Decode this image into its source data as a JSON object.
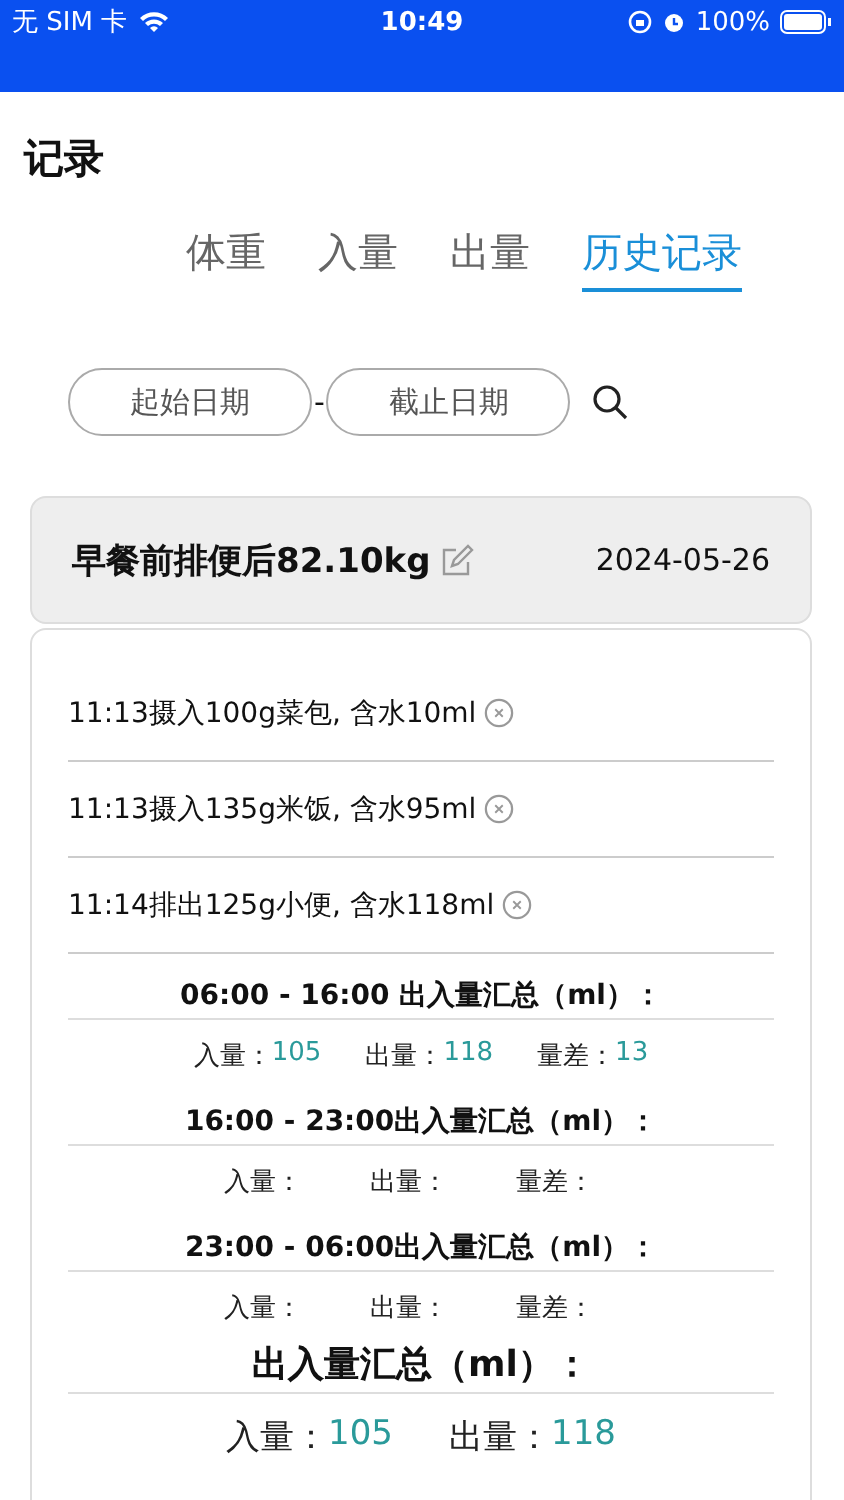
{
  "status_bar": {
    "carrier": "无 SIM 卡",
    "time": "10:49",
    "battery": "100%"
  },
  "title": "记录",
  "tabs": [
    {
      "label": "体重",
      "selected": false
    },
    {
      "label": "入量",
      "selected": false
    },
    {
      "label": "出量",
      "selected": false
    },
    {
      "label": "历史记录",
      "selected": true
    }
  ],
  "date_filter": {
    "start_placeholder": "起始日期",
    "separator": "-",
    "end_placeholder": "截止日期"
  },
  "record": {
    "weight": "早餐前排便后82.10kg",
    "date": "2024-05-26",
    "entries": [
      "11:13摄入100g菜包, 含水10ml",
      "11:13摄入135g米饭, 含水95ml",
      "11:14排出125g小便, 含水118ml"
    ],
    "summaries": [
      {
        "kind": "period",
        "title": "06:00 - 16:00 出入量汇总（ml）：",
        "items": [
          {
            "label": "入量：",
            "value": "105"
          },
          {
            "label": "出量：",
            "value": "118"
          },
          {
            "label": "量差：",
            "value": "13"
          }
        ]
      },
      {
        "kind": "period",
        "title": "16:00 - 23:00出入量汇总（ml）：",
        "items": [
          {
            "label": "入量："
          },
          {
            "label": "出量："
          },
          {
            "label": "量差："
          }
        ]
      },
      {
        "kind": "period",
        "title": "23:00 - 06:00出入量汇总（ml）：",
        "items": [
          {
            "label": "入量："
          },
          {
            "label": "出量："
          },
          {
            "label": "量差："
          }
        ]
      },
      {
        "kind": "total",
        "title": "出入量汇总（ml）：",
        "items": [
          {
            "label": "入量：",
            "value": "105"
          },
          {
            "label": "出量：",
            "value": "118"
          }
        ]
      }
    ]
  }
}
